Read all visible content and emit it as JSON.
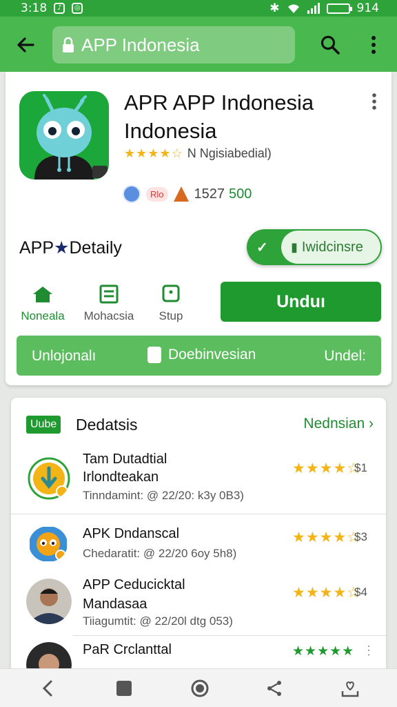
{
  "status_bar": {
    "time": "3:18",
    "battery_text": "914"
  },
  "app_bar": {
    "search_text": "APP Indonesia"
  },
  "app": {
    "title": "APR APP Indonesia Indonesia",
    "rating_label": "Ngisiabedial)",
    "rating_prefix": "N",
    "badge_label": "Rlo",
    "downloads": "1527",
    "downloads_secondary": "500",
    "detail_title_part1": "APP",
    "detail_title_part2": "Detaily",
    "toggle_label": "Iwidcinsre",
    "download_button": "Unduı",
    "nav": [
      {
        "label": "Noneala"
      },
      {
        "label": "Mohacsia"
      },
      {
        "label": "Stup"
      }
    ],
    "bottom_bar": {
      "left": "Unlojonalı",
      "center": "Doebinvesian",
      "right": "Undel:"
    }
  },
  "section": {
    "badge": "Uube",
    "title": "Dedatsis",
    "link": "Nednsian",
    "items": [
      {
        "title": "Tam Dutadtial",
        "title2": "Irlondteakan",
        "sub": "Tinndamint: @ 22/20: k3y 0B3)",
        "stars": "★★★★☆",
        "price": "$1"
      },
      {
        "title": "APK Dndanscal",
        "sub": "Chedaratit: @ 22/20 6oy 5h8)",
        "stars": "★★★★☆",
        "price": "$3"
      },
      {
        "title": "APP Ceducicktal",
        "title2": "Mandasaa",
        "sub": "Tiiagumtit: @ 22/20l dtg 053)",
        "stars": "★★★★☆",
        "price": "$4"
      },
      {
        "title": "PaR Crclanttal",
        "stars": "★★★★★"
      }
    ]
  },
  "colors": {
    "primary": "#2ea33a",
    "accent": "#1f9a2f",
    "star": "#f2b416"
  }
}
